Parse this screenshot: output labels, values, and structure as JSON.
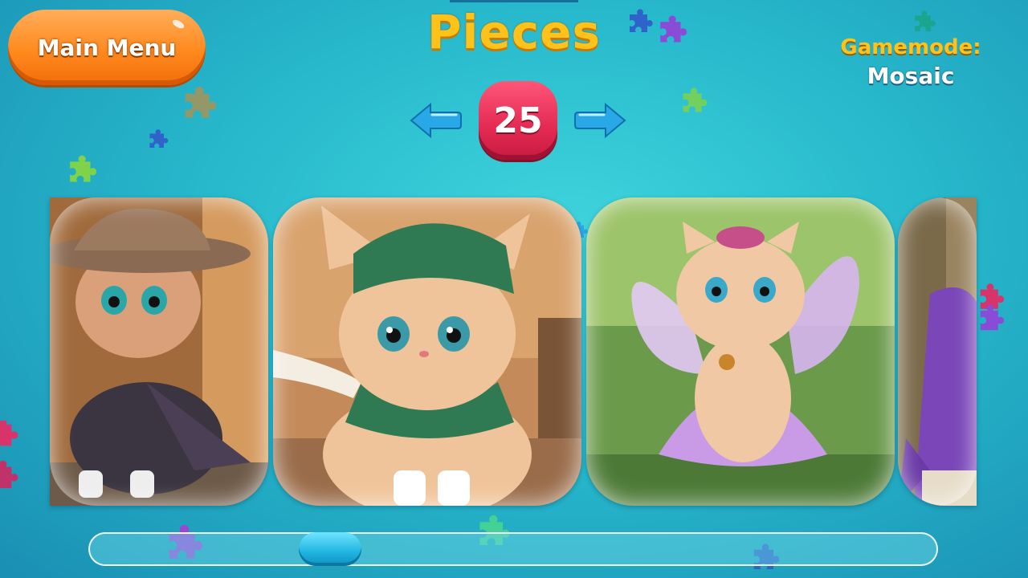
{
  "main_menu": {
    "label": "Main Menu"
  },
  "header": {
    "title": "Pieces"
  },
  "pieces": {
    "count": "25"
  },
  "gamemode": {
    "label": "Gamemode:",
    "value": "Mosaic"
  },
  "cards": [
    {
      "subject": "detective cat in hat and cape"
    },
    {
      "subject": "ranger cat in green hood"
    },
    {
      "subject": "fairy cat with wings"
    },
    {
      "subject": "wizard cat in purple robe"
    }
  ],
  "scrollbar": {
    "position": 0.25
  },
  "colors": {
    "background": "#27b9cc",
    "title": "#ffc21a",
    "main_menu": "#ff8a1e",
    "badge": "#e32a52",
    "arrow": "#29a8e8"
  }
}
